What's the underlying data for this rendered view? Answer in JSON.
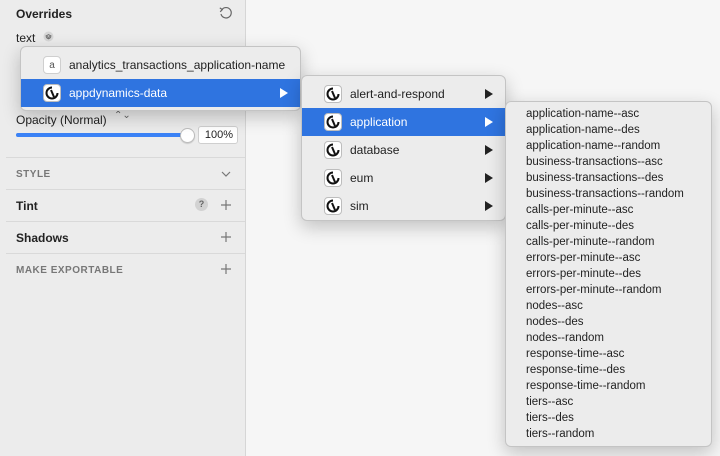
{
  "inspector": {
    "overrides_title": "Overrides",
    "override_label": "text",
    "opacity_label": "Opacity (Normal)",
    "opacity_chevrons": "⌃⌄",
    "opacity_percent": 100,
    "opacity_value": "100%",
    "style_label": "STYLE",
    "tint_label": "Tint",
    "help_glyph": "?",
    "shadows_label": "Shadows",
    "make_exportable_label": "MAKE EXPORTABLE"
  },
  "menus": {
    "level1": [
      {
        "label": "analytics_transactions_application-name",
        "icon": "letter-a-icon",
        "icon_letter": "a",
        "highlighted": false,
        "submenu": false
      },
      {
        "label": "appdynamics-data",
        "icon": "appdynamics-logo-icon",
        "highlighted": true,
        "submenu": true
      }
    ],
    "level2": [
      {
        "label": "alert-and-respond",
        "highlighted": false
      },
      {
        "label": "application",
        "highlighted": true
      },
      {
        "label": "database",
        "highlighted": false
      },
      {
        "label": "eum",
        "highlighted": false
      },
      {
        "label": "sim",
        "highlighted": false
      }
    ],
    "level3": [
      "application-name--asc",
      "application-name--des",
      "application-name--random",
      "business-transactions--asc",
      "business-transactions--des",
      "business-transactions--random",
      "calls-per-minute--asc",
      "calls-per-minute--des",
      "calls-per-minute--random",
      "errors-per-minute--asc",
      "errors-per-minute--des",
      "errors-per-minute--random",
      "nodes--asc",
      "nodes--des",
      "nodes--random",
      "response-time--asc",
      "response-time--des",
      "response-time--random",
      "tiers--asc",
      "tiers--des",
      "tiers--random"
    ]
  },
  "colors": {
    "highlight": "#2f74e0",
    "slider_fill": "#3b82f6",
    "panel_bg": "#ececec"
  }
}
